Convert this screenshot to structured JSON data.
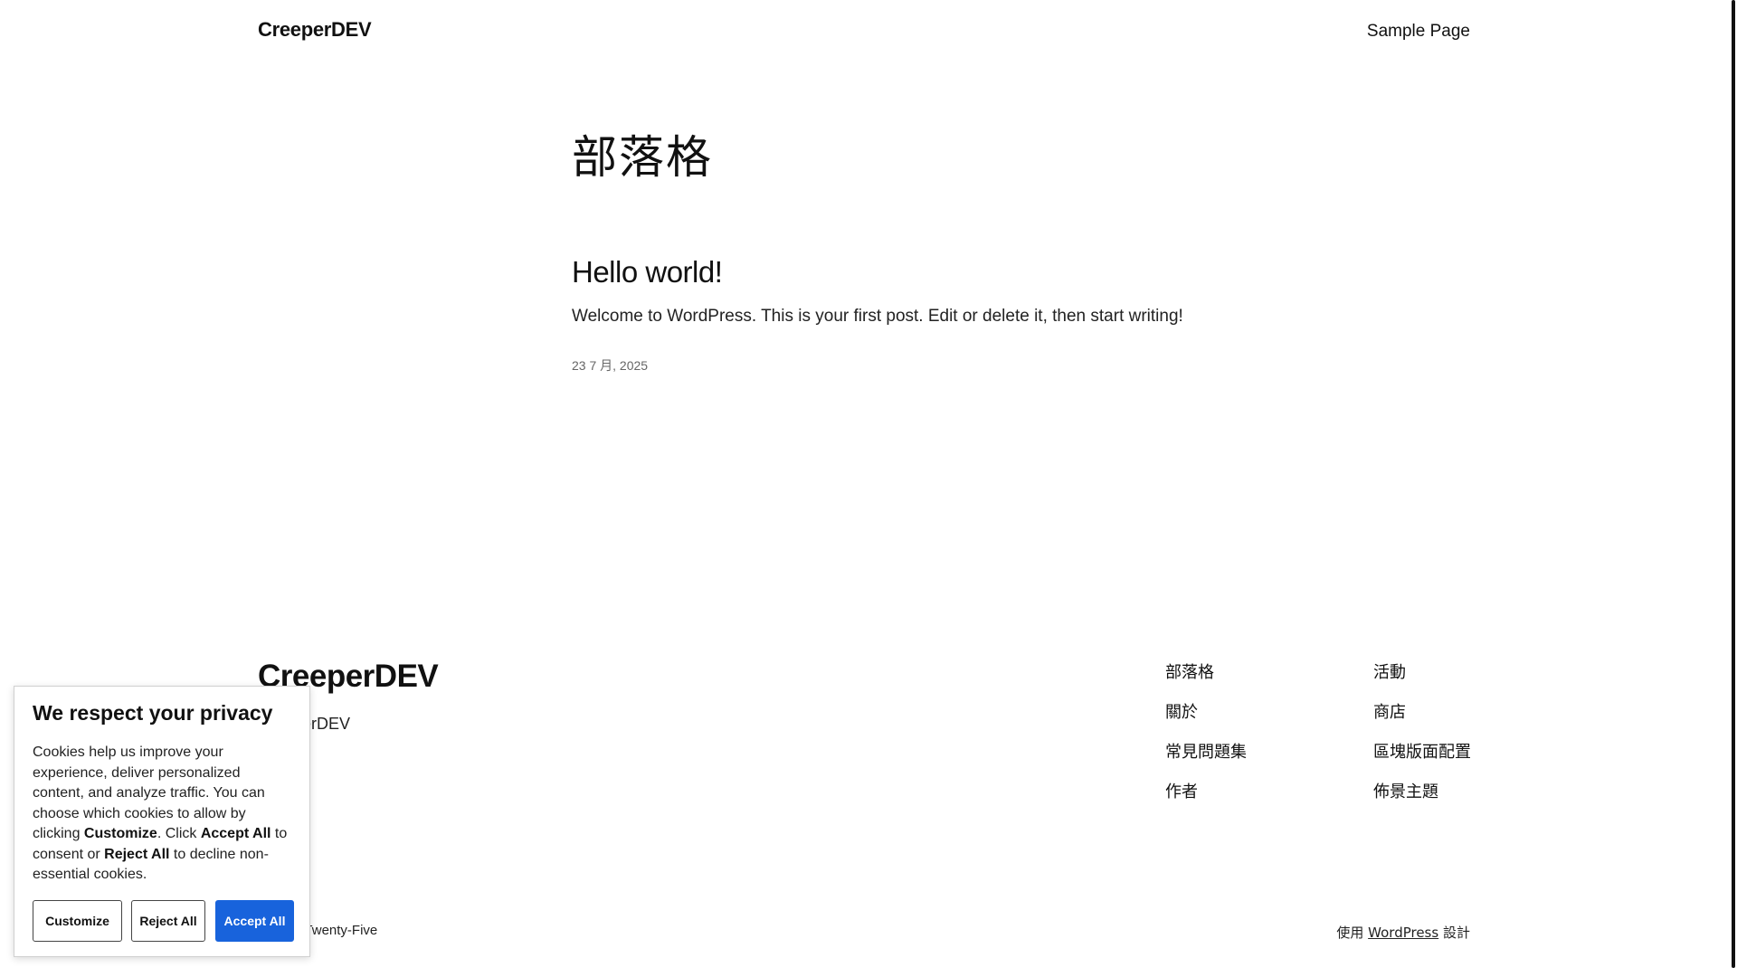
{
  "header": {
    "site_title": "CreeperDEV",
    "nav_link": "Sample Page"
  },
  "main": {
    "heading": "部落格",
    "post": {
      "title": "Hello world!",
      "excerpt": "Welcome to WordPress. This is your first post. Edit or delete it, then start writing!",
      "date": "23 7 月, 2025"
    }
  },
  "footer": {
    "title": "CreeperDEV",
    "tagline": "CreeperDEV",
    "col1": [
      "部落格",
      "關於",
      "常見問題集",
      "作者"
    ],
    "col2": [
      "活動",
      "商店",
      "區塊版面配置",
      "佈景主題"
    ],
    "theme_text": "Twenty Twenty-Five",
    "credit_prefix": "使用",
    "credit_link": "WordPress",
    "credit_suffix": "設計"
  },
  "cookie": {
    "title": "We respect your privacy",
    "text_1": "Cookies help us improve your experience, deliver personalized content, and analyze traffic. You can choose which cookies to allow by clicking ",
    "text_customize": "Customize",
    "text_2": ". Click ",
    "text_accept": "Accept All",
    "text_3": " to consent or ",
    "text_reject": "Reject All",
    "text_4": " to decline non-essential cookies.",
    "btn_customize": "Customize",
    "btn_reject": "Reject All",
    "btn_accept": "Accept All",
    "accent_color": "#1863dc"
  }
}
